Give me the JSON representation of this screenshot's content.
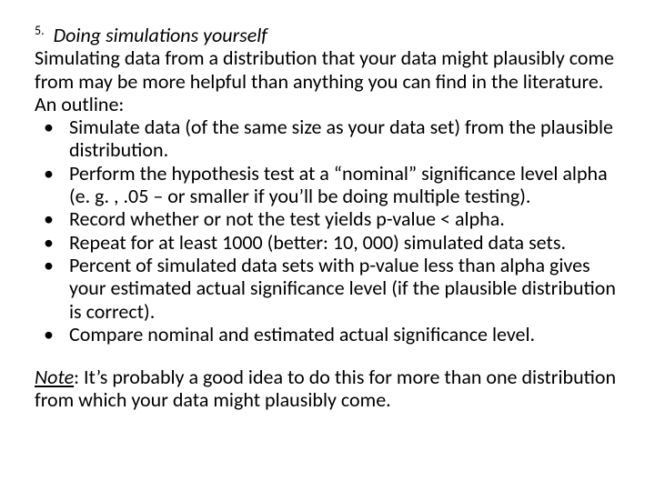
{
  "heading": {
    "number": "5.",
    "title": "Doing simulations yourself"
  },
  "intro": "Simulating data from a distribution that your data might plausibly come from may be more helpful than anything you can find in the literature. An outline:",
  "bullets": {
    "dot": "•",
    "items": [
      "Simulate data (of the same size as your data set) from the plausible distribution.",
      "Perform the hypothesis test at a “nominal” significance level alpha (e. g. , .05 – or smaller if you’ll be doing multiple testing).",
      "Record whether or not the test yields p-value < alpha.",
      "Repeat for at least 1000 (better: 10, 000) simulated data sets.",
      "Percent of simulated data sets with p-value less than alpha gives your estimated actual significance level (if the plausible distribution is correct).",
      "Compare nominal and estimated actual significance level."
    ]
  },
  "note": {
    "label": "Note",
    "text": ": It’s probably a good idea to do this for more than one distribution from which your data might plausibly come."
  }
}
